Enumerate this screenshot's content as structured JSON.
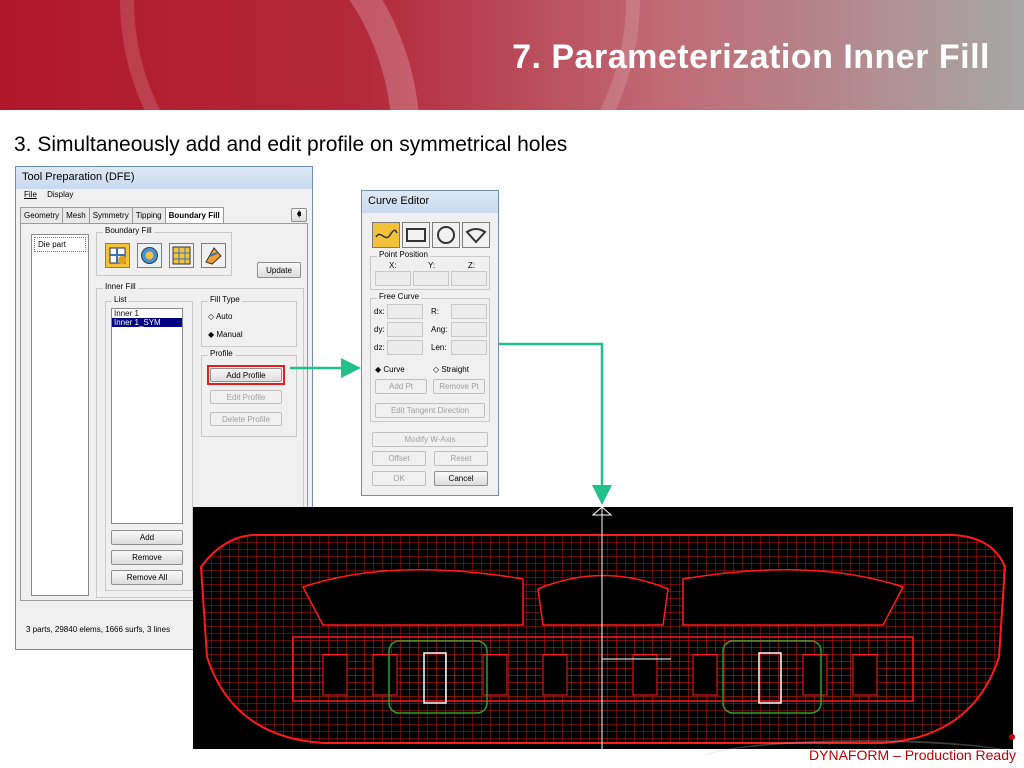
{
  "slide": {
    "title": "7. Parameterization Inner Fill",
    "subtitle": "3. Simultaneously add and edit profile on symmetrical holes",
    "footer": "DYNAFORM – Production Ready"
  },
  "tool_prep": {
    "title": "Tool Preparation (DFE)",
    "menu": [
      "File",
      "Display"
    ],
    "tabs": [
      "Geometry",
      "Mesh",
      "Symmetry",
      "Tipping",
      "Boundary Fill"
    ],
    "active_tab": "Boundary Fill",
    "part_list": [
      "Die part"
    ],
    "boundary_fill_label": "Boundary Fill",
    "update_button": "Update",
    "inner_fill_label": "Inner Fill",
    "list_label": "List",
    "list_items": [
      "Inner 1",
      "Inner 1_SYM"
    ],
    "selected_item": "Inner 1_SYM",
    "fill_type_label": "Fill Type",
    "fill_type_options": [
      "Auto",
      "Manual"
    ],
    "fill_type_selected": "Manual",
    "profile_label": "Profile",
    "add_profile": "Add Profile",
    "edit_profile": "Edit Profile",
    "delete_profile": "Delete Profile",
    "add": "Add",
    "remove": "Remove",
    "remove_all": "Remove All",
    "status": "3 parts, 29840 elems, 1666 surfs, 3 lines"
  },
  "curve_editor": {
    "title": "Curve Editor",
    "point_position_label": "Point Position",
    "x_label": "X:",
    "y_label": "Y:",
    "z_label": "Z:",
    "free_curve_label": "Free Curve",
    "dx_label": "dx:",
    "dy_label": "dy:",
    "dz_label": "dz:",
    "r_label": "R:",
    "ang_label": "Ang:",
    "len_label": "Len:",
    "mode_options": [
      "Curve",
      "Straight"
    ],
    "mode_selected": "Curve",
    "add_pt": "Add Pt",
    "remove_pt": "Remove Pt",
    "edit_tangent": "Edit Tangent Direction",
    "modify_w_axis": "Modify W-Axis",
    "offset": "Offset",
    "reset": "Reset",
    "ok": "OK",
    "cancel": "Cancel"
  },
  "colors": {
    "mesh": "#ff1a1a",
    "highlight": "#2aa02a",
    "arrow": "#22c08a",
    "selection": "#000080",
    "add_profile_outline": "#e02020"
  }
}
